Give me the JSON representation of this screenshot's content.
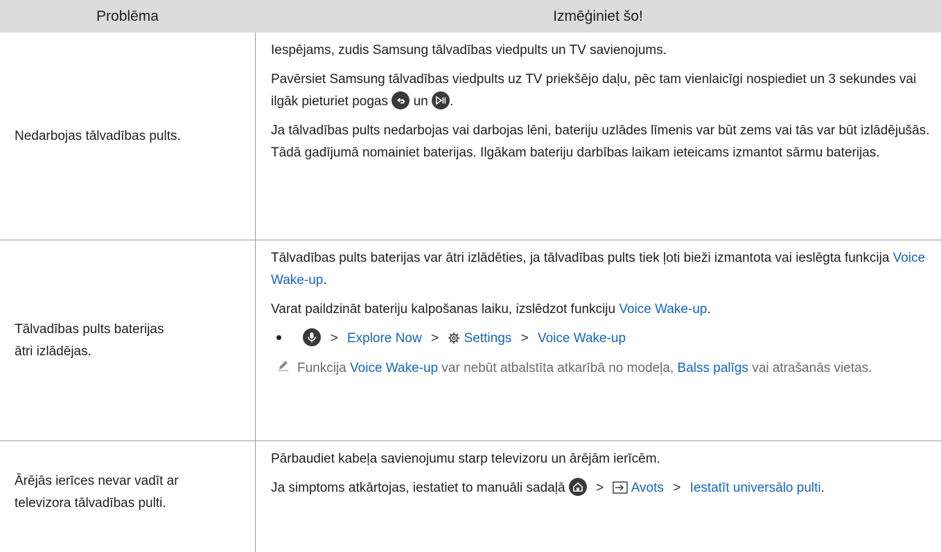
{
  "header": {
    "col1": "Problēma",
    "col2": "Izmēģiniet šo!"
  },
  "rows": [
    {
      "problem": "Nedarbojas tālvadības pults.",
      "p1": "Iespējams, zudis Samsung tālvadības viedpults un TV savienojums.",
      "p2a": "Pavērsiet Samsung tālvadības viedpults uz TV priekšējo daļu, pēc tam vienlaicīgi nospiediet un 3 sekundes vai ilgāk pieturiet pogas",
      "p2b": "un",
      "p2c": ".",
      "p3": "Ja tālvadības pults nedarbojas vai darbojas lēni, bateriju uzlādes līmenis var būt zems vai tās var būt izlādējušās. Tādā gadījumā nomainiet baterijas. Ilgākam bateriju darbības laikam ieteicams izmantot sārmu baterijas."
    },
    {
      "problem": "Tālvadības pults baterijas ātri izlādējas.",
      "p1a": "Tālvadības pults baterijas var ātri izlādēties, ja tālvadības pults tiek ļoti bieži izmantota vai ieslēgta funkcija",
      "p1link": "Voice Wake-up",
      "p1end": ".",
      "p2a": "Varat paildzināt bateriju kalpošanas laiku, izslēdzot funkciju",
      "p2link": "Voice Wake-up",
      "p2end": ".",
      "path": [
        "Explore Now",
        "Settings",
        "Voice Wake-up"
      ],
      "note_a": "Funkcija",
      "note_link1": "Voice Wake-up",
      "note_b": "var nebūt atbalstīta atkarībā no modeļa,",
      "note_link2": "Balss palīgs",
      "note_c": "vai atrašanās vietas."
    },
    {
      "problem": "Ārējās ierīces nevar vadīt ar televizora tālvadības pulti.",
      "p1": "Pārbaudiet kabeļa savienojumu starp televizoru un ārējām ierīcēm.",
      "p2a": "Ja simptoms atkārtojas, iestatiet to manuāli sadaļā",
      "path": [
        "Avots",
        "Iestatīt universālo pulti"
      ],
      "p2end": "."
    }
  ],
  "icons": {
    "return": "return-arrow-icon",
    "playpause": "play-pause-icon",
    "mic": "microphone-icon",
    "gear": "gear-icon",
    "home": "home-icon",
    "source": "source-input-icon",
    "note": "pencil-note-icon"
  },
  "colors": {
    "link": "#1565c0",
    "header_bg": "#dcdcdc",
    "note_text": "#6a6a6a"
  }
}
